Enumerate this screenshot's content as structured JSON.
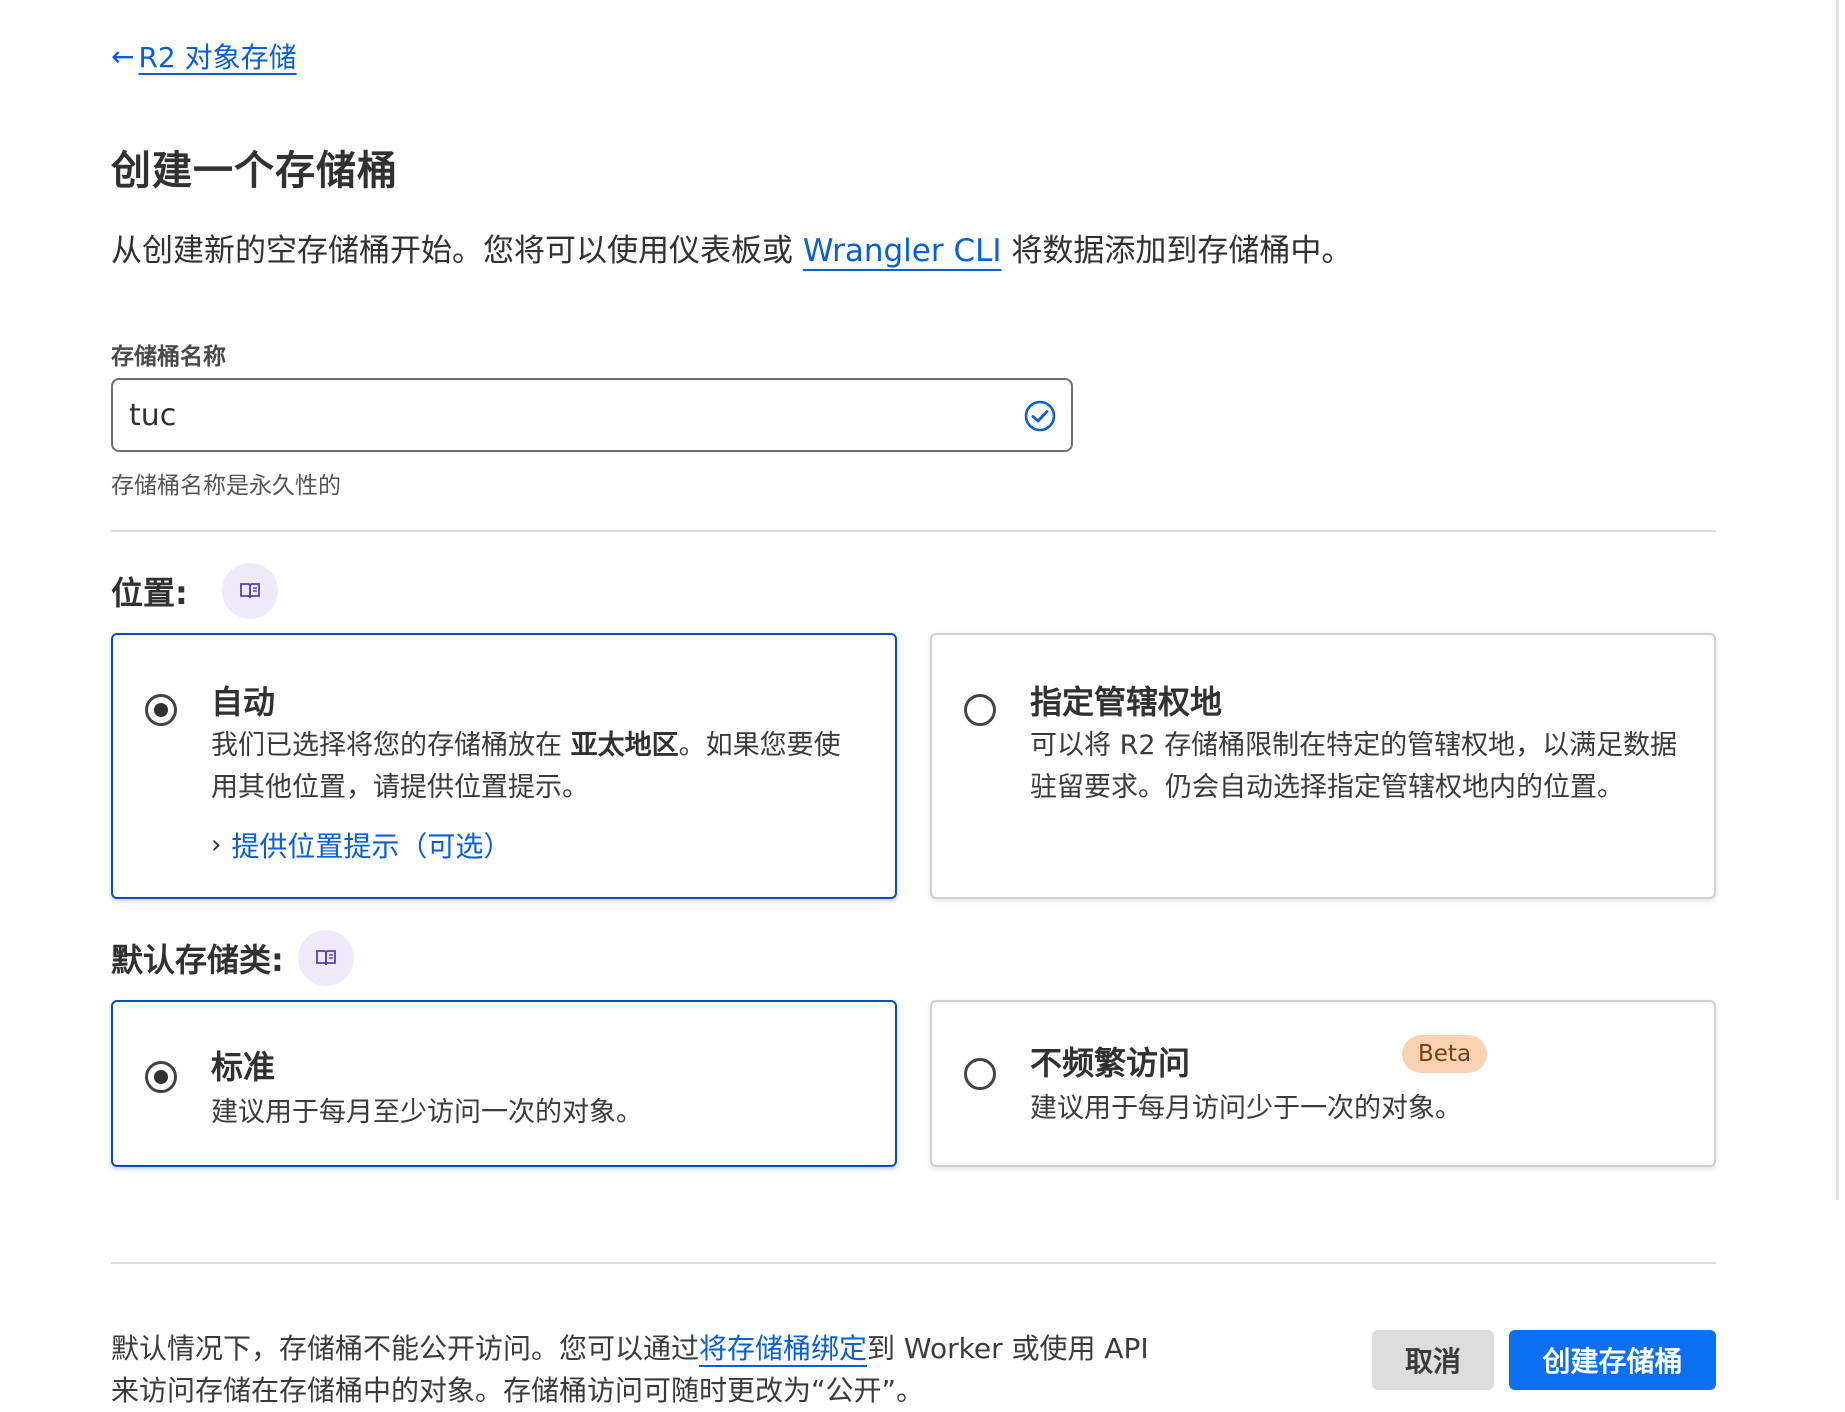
{
  "back_link": {
    "arrow": "←",
    "label": "R2 对象存储"
  },
  "title": "创建一个存储桶",
  "intro": {
    "before": "从创建新的空存储桶开始。您将可以使用仪表板或 ",
    "link": "Wrangler CLI",
    "after": " 将数据添加到存储桶中。"
  },
  "bucket_name": {
    "label": "存储桶名称",
    "value": "tuc",
    "helper": "存储桶名称是永久性的",
    "valid_icon": "check-circle-icon"
  },
  "location": {
    "heading": "位置:",
    "doc_icon": "book-icon",
    "options": [
      {
        "title": "自动",
        "body_before": "我们已选择将您的存储桶放在 ",
        "body_bold": "亚太地区",
        "body_after": "。如果您要使用其他位置，请提供位置提示。",
        "expander": "提供位置提示（可选）",
        "selected": true
      },
      {
        "title": "指定管辖权地",
        "body": "可以将 R2 存储桶限制在特定的管辖权地，以满足数据驻留要求。仍会自动选择指定管辖权地内的位置。",
        "selected": false
      }
    ]
  },
  "storage_class": {
    "heading": "默认存储类:",
    "doc_icon": "book-icon",
    "options": [
      {
        "title": "标准",
        "body": "建议用于每月至少访问一次的对象。",
        "selected": true
      },
      {
        "title": "不频繁访问",
        "badge": "Beta",
        "body": "建议用于每月访问少于一次的对象。",
        "selected": false
      }
    ]
  },
  "footer": {
    "before": "默认情况下，存储桶不能公开访问。您可以通过",
    "link": "将存储桶绑定",
    "after": "到 Worker 或使用 API 来访问存储在存储桶中的对象。存储桶访问可随时更改为“公开”。",
    "cancel_label": "取消",
    "create_label": "创建存储桶"
  },
  "colors": {
    "accent": "#0a5fd6",
    "primary_button": "#0b6ff2",
    "selected_border": "#0a4fb8",
    "beta_badge": "#fbd3b3"
  }
}
